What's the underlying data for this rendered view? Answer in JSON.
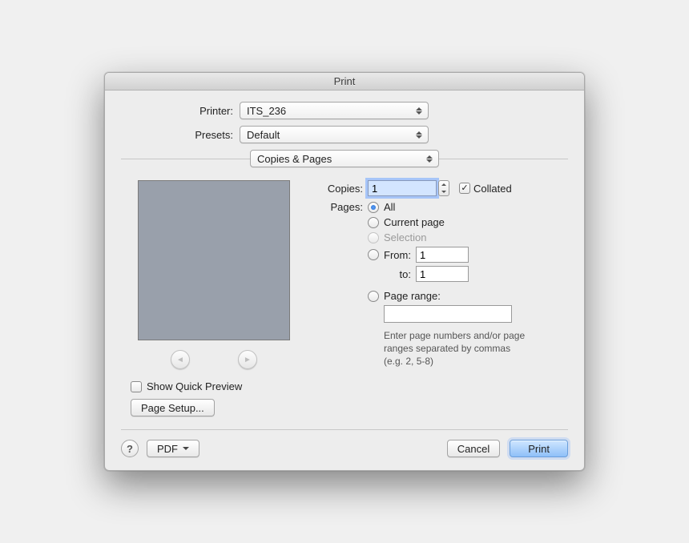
{
  "window": {
    "title": "Print"
  },
  "printer": {
    "label": "Printer:",
    "value": "ITS_236"
  },
  "presets": {
    "label": "Presets:",
    "value": "Default"
  },
  "section": {
    "value": "Copies & Pages"
  },
  "copies": {
    "label": "Copies:",
    "value": "1"
  },
  "collated": {
    "label": "Collated",
    "checked": true
  },
  "pages": {
    "label": "Pages:",
    "all": {
      "label": "All",
      "selected": true
    },
    "current": {
      "label": "Current page"
    },
    "selection": {
      "label": "Selection",
      "disabled": true
    },
    "from": {
      "label": "From:",
      "value": "1"
    },
    "to": {
      "label": "to:",
      "value": "1"
    },
    "range": {
      "label": "Page range:",
      "value": ""
    },
    "hint": "Enter page numbers and/or page ranges separated by commas (e.g. 2, 5-8)"
  },
  "preview": {
    "show_label": "Show Quick Preview",
    "page_setup": "Page Setup..."
  },
  "footer": {
    "pdf": "PDF",
    "cancel": "Cancel",
    "print": "Print"
  }
}
